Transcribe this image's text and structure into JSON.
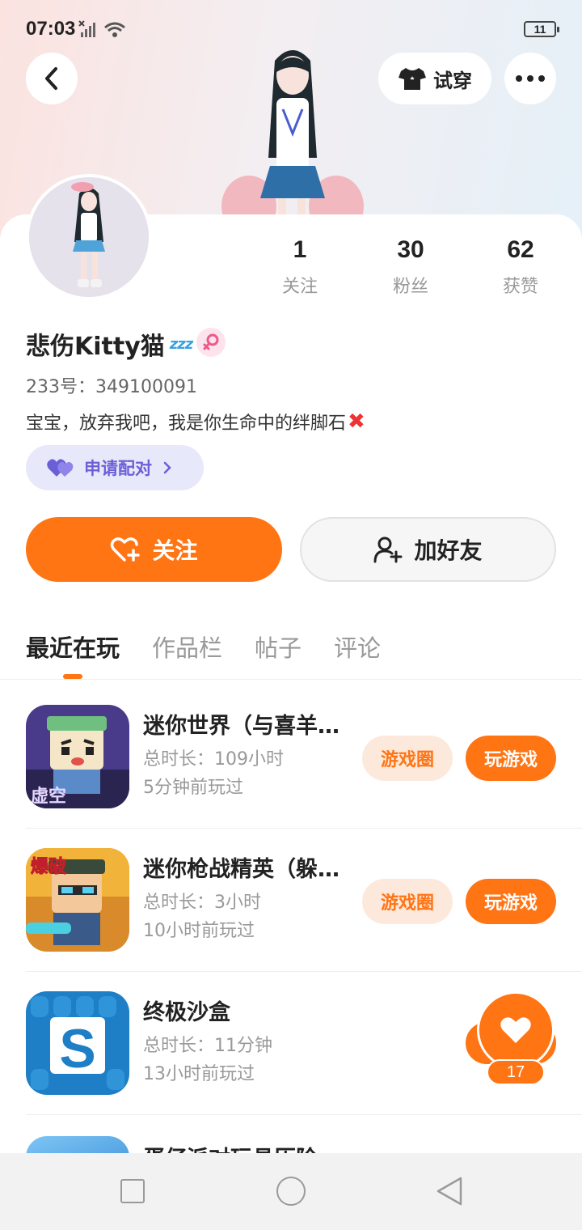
{
  "status_bar": {
    "time": "07:03",
    "battery": "11",
    "icons": [
      "signal-off-icon",
      "wifi-icon",
      "battery-icon"
    ]
  },
  "header": {
    "tryon_label": "试穿",
    "icons": [
      "back-icon",
      "tshirt-icon",
      "more-icon"
    ]
  },
  "profile": {
    "username": "悲伤Kitty猫",
    "username_emoji": "zzz",
    "gender": "female",
    "user_id": "233号：349100091",
    "bio": "宝宝，放弃我吧，我是你生命中的绊脚石",
    "bio_emoji": "✖",
    "pair_label": "申请配对",
    "stats": [
      {
        "value": "1",
        "label": "关注"
      },
      {
        "value": "30",
        "label": "粉丝"
      },
      {
        "value": "62",
        "label": "获赞"
      }
    ]
  },
  "actions": {
    "follow_label": "关注",
    "add_friend_label": "加好友"
  },
  "tabs": [
    {
      "label": "最近在玩",
      "active": true
    },
    {
      "label": "作品栏",
      "active": false
    },
    {
      "label": "帖子",
      "active": false
    },
    {
      "label": "评论",
      "active": false
    }
  ],
  "games": [
    {
      "name": "迷你世界（与喜羊…",
      "total_time": "总时长：109小时",
      "last_played": "5分钟前玩过",
      "circle_label": "游戏圈",
      "play_label": "玩游戏",
      "icon_label": "虚空"
    },
    {
      "name": "迷你枪战精英（躲…",
      "total_time": "总时长：3小时",
      "last_played": "10小时前玩过",
      "circle_label": "游戏圈",
      "play_label": "玩游戏",
      "icon_label": "爆破"
    },
    {
      "name": "终极沙盒",
      "total_time": "总时长：11分钟",
      "last_played": "13小时前玩过",
      "icon_label": "S"
    },
    {
      "name": "蛋仔派对玩具历险"
    }
  ],
  "like_float": {
    "count": "17"
  },
  "colors": {
    "accent": "#ff7413",
    "accent_light": "#fde9dc",
    "pair_purple": "#6b5fd6",
    "pair_bg": "#e8e8fb"
  }
}
